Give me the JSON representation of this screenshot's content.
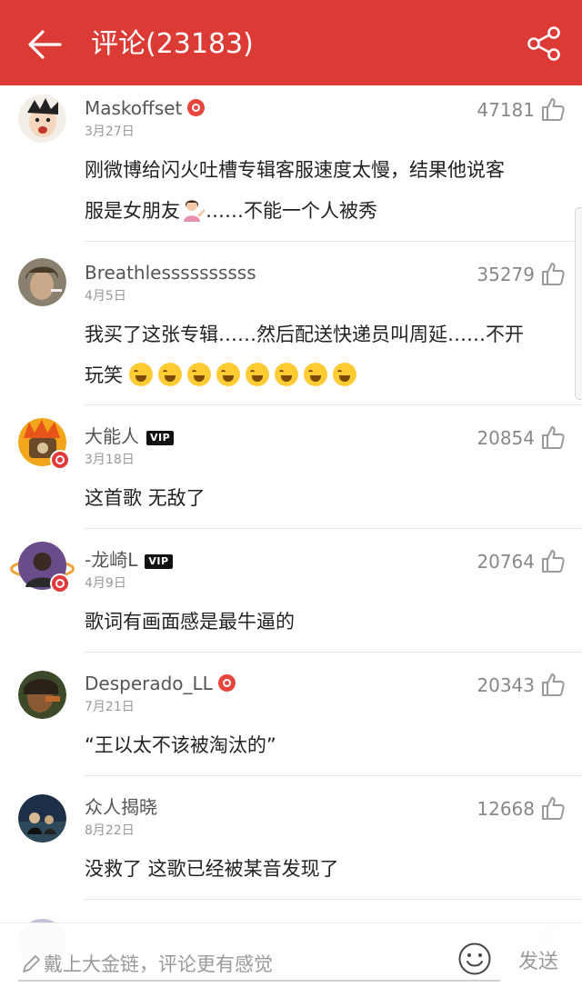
{
  "header": {
    "title": "评论(23183)",
    "background": "#dc3b35"
  },
  "comments": [
    {
      "username": "Maskoffset",
      "badge": "verified",
      "date": "3月27日",
      "likes": "47181",
      "line1": "刚微博给闪火吐槽专辑客服速度太慢，结果他说客",
      "line2_before": "服是女朋友",
      "line2_after": "……不能一个人被秀"
    },
    {
      "username": "Breathlessssssssss",
      "badge": "none",
      "date": "4月5日",
      "likes": "35279",
      "line1": "我买了这张专辑……然后配送快递员叫周延……不开",
      "line2": "玩笑"
    },
    {
      "username": "大能人",
      "badge": "vip",
      "vip_label": "VIP",
      "date": "3月18日",
      "likes": "20854",
      "text": "这首歌 无敌了"
    },
    {
      "username": "-龙崎L",
      "badge": "vip",
      "vip_label": "VIP",
      "date": "4月9日",
      "likes": "20764",
      "text": "歌词有画面感是最牛逼的"
    },
    {
      "username": "Desperado_LL",
      "badge": "verified",
      "date": "7月21日",
      "likes": "20343",
      "text": "“王以太不该被淘汰的”"
    },
    {
      "username": "众人揭晓",
      "badge": "none",
      "date": "8月22日",
      "likes": "12668",
      "text": "没救了 这歌已经被某音发现了"
    }
  ],
  "bottom_bar": {
    "placeholder": "戴上大金链，评论更有感觉",
    "send_label": "发送"
  },
  "icons": {
    "back": "back-arrow-icon",
    "share": "share-icon",
    "like": "thumbs-up-icon",
    "emoji": "smiley-icon",
    "pencil": "pencil-icon"
  },
  "colors": {
    "accent": "#dc3b35",
    "verified": "#e8453c",
    "muted": "#999999"
  }
}
